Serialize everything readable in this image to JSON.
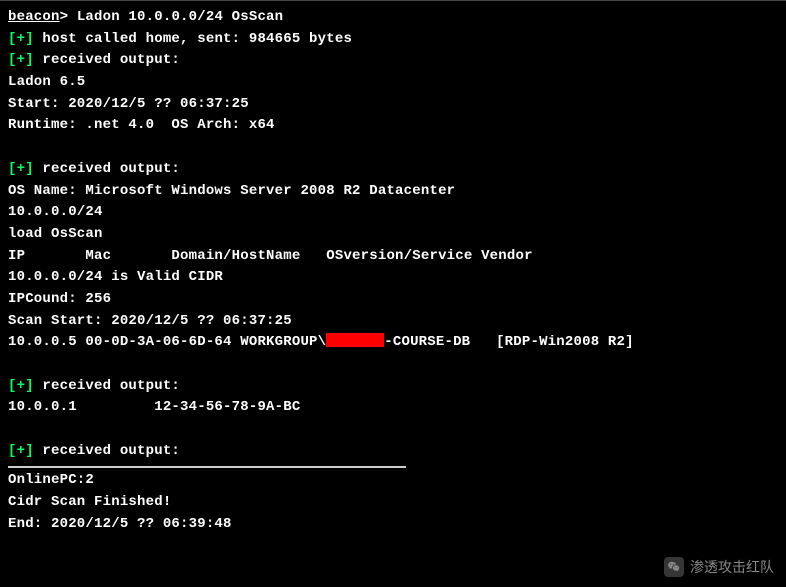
{
  "prompt": {
    "label": "beacon",
    "chevron": ">",
    "command": "Ladon 10.0.0.0/24 OsScan"
  },
  "tags": {
    "plus": "[+]"
  },
  "lines": {
    "l1": " host called home, sent: 984665 bytes",
    "l2": " received output:",
    "l3": "Ladon 6.5",
    "l4": "Start: 2020/12/5 ?? 06:37:25",
    "l5": "Runtime: .net 4.0  OS Arch: x64",
    "l6": " received output:",
    "l7": "OS Name: Microsoft Windows Server 2008 R2 Datacenter",
    "l8": "10.0.0.0/24",
    "l9": "load OsScan",
    "l10": "IP       Mac       Domain/HostName   OSversion/Service Vendor",
    "l11": "10.0.0.0/24 is Valid CIDR",
    "l12": "IPCound: 256",
    "l13": "Scan Start: 2020/12/5 ?? 06:37:25",
    "l14a": "10.0.0.5 00-0D-3A-06-6D-64 WORKGROUP\\",
    "l14b": "-COURSE-DB   [RDP-Win2008 R2]",
    "l15": " received output:",
    "l16": "10.0.0.1         12-34-56-78-9A-BC",
    "l17": " received output:",
    "l18": "OnlinePC:2",
    "l19": "Cidr Scan Finished!",
    "l20": "End: 2020/12/5 ?? 06:39:48"
  },
  "watermark": {
    "text": "渗透攻击红队"
  }
}
